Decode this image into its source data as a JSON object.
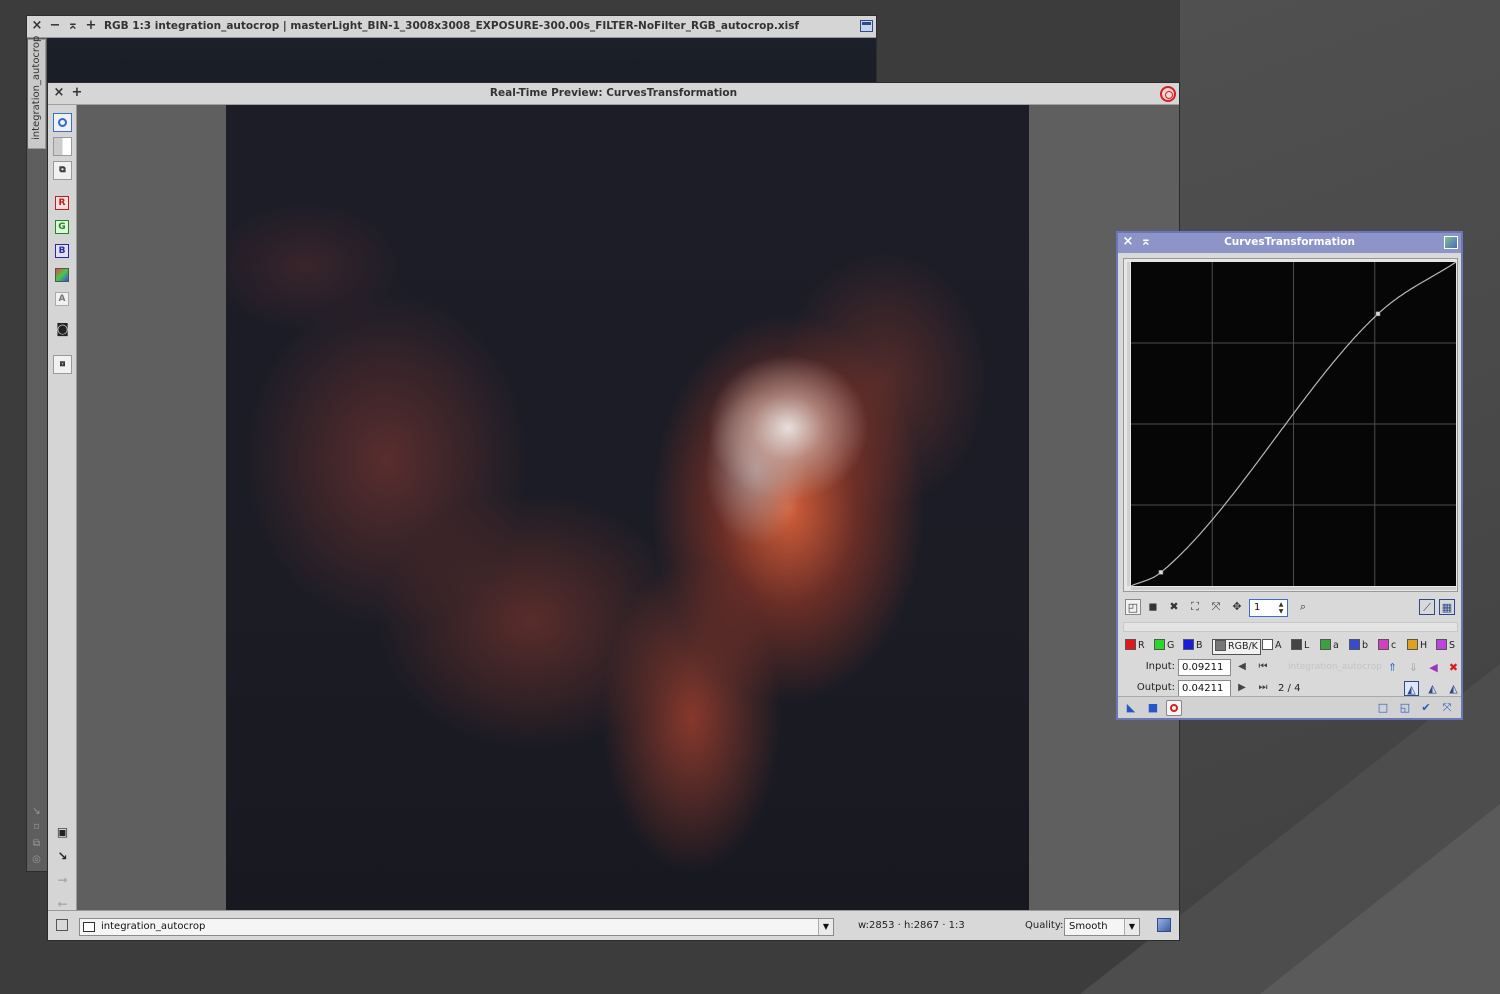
{
  "main_window": {
    "title": "RGB 1:3 integration_autocrop | masterLight_BIN-1_3008x3008_EXPOSURE-300.00s_FILTER-NoFilter_RGB_autocrop.xisf",
    "side_tab": "integration_autocrop",
    "controls": {
      "close": "×",
      "minimize": "−",
      "shade": "⌅",
      "maximize": "+"
    }
  },
  "preview_window": {
    "title": "Real-Time Preview: CurvesTransformation",
    "controls": {
      "close": "×",
      "maximize": "+"
    },
    "toolbar_channels": {
      "r": "R",
      "g": "G",
      "b": "B",
      "a": "A"
    },
    "statusbar": {
      "view": "integration_autocrop",
      "dims": "w:2853 · h:2867 · 1:3",
      "quality_label": "Quality:",
      "quality_value": "Smooth"
    }
  },
  "curves": {
    "title": "CurvesTransformation",
    "controls": {
      "close": "×",
      "shade": "⌅"
    },
    "zoom_value": "1",
    "channels": [
      {
        "label": "R",
        "color": "#e01818"
      },
      {
        "label": "G",
        "color": "#2ad82a"
      },
      {
        "label": "B",
        "color": "#1a1ae0"
      },
      {
        "label": "RGB/K",
        "color": "#777777"
      },
      {
        "label": "A",
        "color": "#ffffff"
      },
      {
        "label": "L",
        "color": "#444444"
      },
      {
        "label": "a",
        "color": "#3aa040"
      },
      {
        "label": "b",
        "color": "#3a4ad0"
      },
      {
        "label": "c",
        "color": "#d040c0"
      },
      {
        "label": "H",
        "color": "#e0a020"
      },
      {
        "label": "S",
        "color": "#c040e0"
      }
    ],
    "selected_channel": "RGB/K",
    "input_label": "Input:",
    "input_value": "0.09211",
    "output_label": "Output:",
    "output_value": "0.04211",
    "point_count": "2 / 4",
    "ghost_view": "integration_autocrop",
    "curve_points": [
      [
        0.0,
        0.0
      ],
      [
        0.09211,
        0.04211
      ],
      [
        0.76,
        0.84
      ],
      [
        1.0,
        1.0
      ]
    ],
    "colors": {
      "accent": "#3a6fd0",
      "title_bar": "#8d94c8",
      "grid": "#4c4c4c"
    }
  }
}
